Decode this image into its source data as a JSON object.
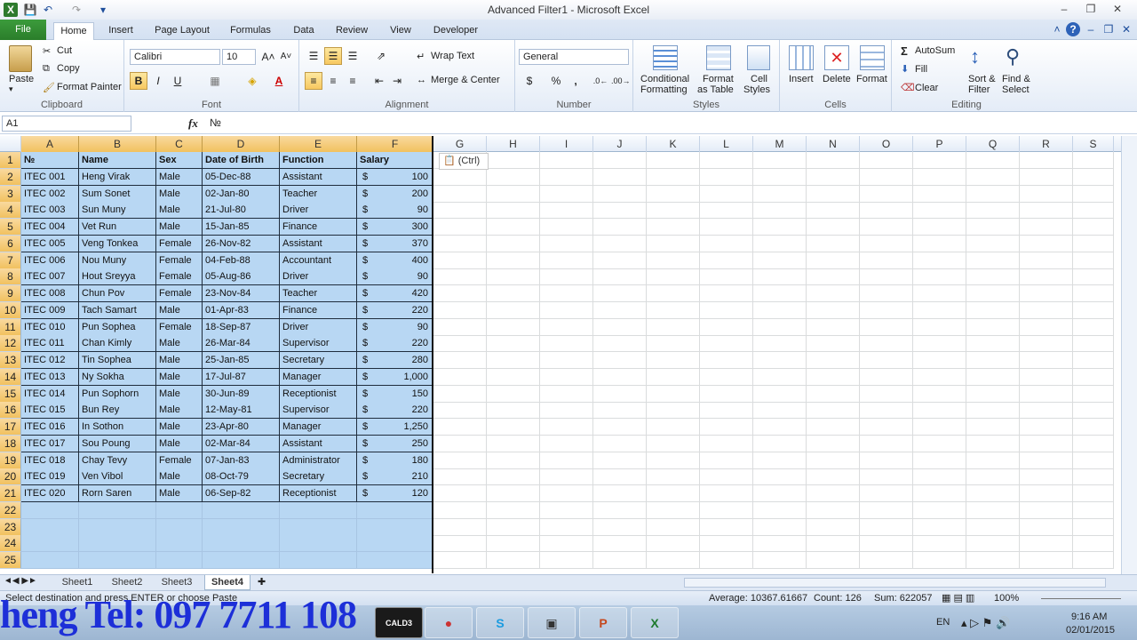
{
  "window": {
    "title": "Advanced Filter1 - Microsoft Excel"
  },
  "tabs": [
    {
      "label": "File"
    },
    {
      "label": "Home"
    },
    {
      "label": "Insert"
    },
    {
      "label": "Page Layout"
    },
    {
      "label": "Formulas"
    },
    {
      "label": "Data"
    },
    {
      "label": "Review"
    },
    {
      "label": "View"
    },
    {
      "label": "Developer"
    }
  ],
  "ribbon": {
    "clipboard": {
      "paste": "Paste",
      "cut": "Cut",
      "copy": "Copy",
      "format_painter": "Format Painter",
      "label": "Clipboard"
    },
    "font": {
      "name": "Calibri",
      "size": "10",
      "label": "Font",
      "bold": "B",
      "italic": "I",
      "underline": "U"
    },
    "alignment": {
      "wrap": "Wrap Text",
      "merge": "Merge & Center",
      "label": "Alignment"
    },
    "number": {
      "format": "General",
      "currency": "$",
      "percent": "%",
      "comma": ",",
      "label": "Number"
    },
    "styles": {
      "conditional": "Conditional",
      "conditional2": "Formatting",
      "format_table": "Format",
      "format_table2": "as Table",
      "cell": "Cell",
      "cell2": "Styles",
      "label": "Styles"
    },
    "cells": {
      "insert": "Insert",
      "delete": "Delete",
      "format": "Format",
      "label": "Cells"
    },
    "editing": {
      "autosum": "AutoSum",
      "fill": "Fill",
      "clear": "Clear",
      "sort": "Sort &",
      "sort2": "Filter",
      "find": "Find &",
      "find2": "Select",
      "label": "Editing"
    }
  },
  "formula_bar": {
    "name_box": "A1",
    "fx": "fx",
    "formula": "№"
  },
  "columns": [
    "A",
    "B",
    "C",
    "D",
    "E",
    "F",
    "G",
    "H",
    "I",
    "J",
    "K",
    "L",
    "M",
    "N",
    "O",
    "P",
    "Q",
    "R",
    "S"
  ],
  "headers": [
    "№",
    "Name",
    "Sex",
    "Date of Birth",
    "Function",
    "Salary"
  ],
  "rows": [
    [
      "ITEC 001",
      "Heng Virak",
      "Male",
      "05-Dec-88",
      "Assistant",
      "$",
      "100"
    ],
    [
      "ITEC 002",
      "Sum Sonet",
      "Male",
      "02-Jan-80",
      "Teacher",
      "$",
      "200"
    ],
    [
      "ITEC 003",
      "Sun Muny",
      "Male",
      "21-Jul-80",
      "Driver",
      "$",
      "90"
    ],
    [
      "ITEC 004",
      "Vet Run",
      "Male",
      "15-Jan-85",
      "Finance",
      "$",
      "300"
    ],
    [
      "ITEC 005",
      "Veng Tonkea",
      "Female",
      "26-Nov-82",
      "Assistant",
      "$",
      "370"
    ],
    [
      "ITEC 006",
      "Nou Muny",
      "Female",
      "04-Feb-88",
      "Accountant",
      "$",
      "400"
    ],
    [
      "ITEC 007",
      "Hout Sreyya",
      "Female",
      "05-Aug-86",
      "Driver",
      "$",
      "90"
    ],
    [
      "ITEC 008",
      "Chun Pov",
      "Female",
      "23-Nov-84",
      "Teacher",
      "$",
      "420"
    ],
    [
      "ITEC 009",
      "Tach Samart",
      "Male",
      "01-Apr-83",
      "Finance",
      "$",
      "220"
    ],
    [
      "ITEC 010",
      "Pun Sophea",
      "Female",
      "18-Sep-87",
      "Driver",
      "$",
      "90"
    ],
    [
      "ITEC 011",
      "Chan Kimly",
      "Male",
      "26-Mar-84",
      "Supervisor",
      "$",
      "220"
    ],
    [
      "ITEC 012",
      "Tin Sophea",
      "Male",
      "25-Jan-85",
      "Secretary",
      "$",
      "280"
    ],
    [
      "ITEC 013",
      "Ny Sokha",
      "Male",
      "17-Jul-87",
      "Manager",
      "$",
      "1,000"
    ],
    [
      "ITEC 014",
      "Pun Sophorn",
      "Male",
      "30-Jun-89",
      "Receptionist",
      "$",
      "150"
    ],
    [
      "ITEC 015",
      "Bun Rey",
      "Male",
      "12-May-81",
      "Supervisor",
      "$",
      "220"
    ],
    [
      "ITEC 016",
      "In Sothon",
      "Male",
      "23-Apr-80",
      "Manager",
      "$",
      "1,250"
    ],
    [
      "ITEC 017",
      "Sou Poung",
      "Male",
      "02-Mar-84",
      "Assistant",
      "$",
      "250"
    ],
    [
      "ITEC 018",
      "Chay Tevy",
      "Female",
      "07-Jan-83",
      "Administrator",
      "$",
      "180"
    ],
    [
      "ITEC 019",
      "Ven Vibol",
      "Male",
      "08-Oct-79",
      "Secretary",
      "$",
      "210"
    ],
    [
      "ITEC 020",
      "Rorn Saren",
      "Male",
      "06-Sep-82",
      "Receptionist",
      "$",
      "120"
    ]
  ],
  "row_numbers": [
    "1",
    "2",
    "3",
    "4",
    "5",
    "6",
    "7",
    "8",
    "9",
    "10",
    "11",
    "12",
    "13",
    "14",
    "15",
    "16",
    "17",
    "18",
    "19",
    "20",
    "21",
    "22",
    "23",
    "24",
    "25"
  ],
  "paste_options": "(Ctrl)",
  "sheets": [
    "Sheet1",
    "Sheet2",
    "Sheet3",
    "Sheet4"
  ],
  "active_sheet": "Sheet4",
  "status": {
    "message": "Select destination and press ENTER or choose Paste",
    "average": "Average: 10367.61667",
    "count": "Count: 126",
    "sum": "Sum: 622057",
    "zoom": "100%"
  },
  "taskbar": {
    "watermark": "heng Tel: 097 7711 108",
    "lang": "EN",
    "time": "9:16 AM",
    "date": "02/01/2015",
    "apps": [
      "CALD3"
    ]
  }
}
